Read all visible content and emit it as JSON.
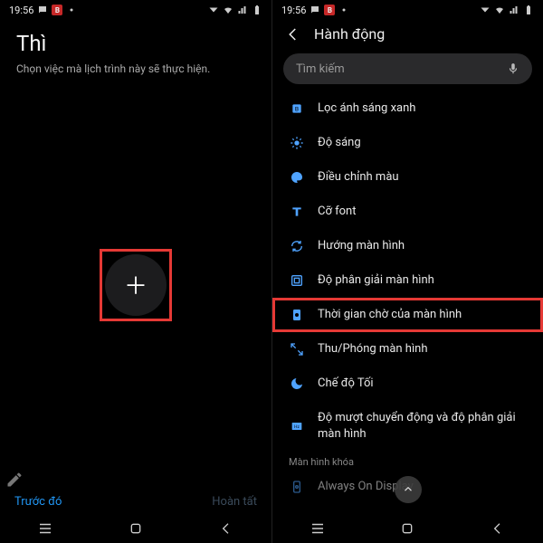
{
  "status": {
    "time": "19:56"
  },
  "left": {
    "title": "Thì",
    "subtitle": "Chọn việc mà lịch trình này sẽ thực hiện.",
    "prev": "Trước đó",
    "done": "Hoàn tất"
  },
  "right": {
    "header": "Hành động",
    "search_placeholder": "Tìm kiếm",
    "items": [
      {
        "label": "Lọc ánh sáng xanh"
      },
      {
        "label": "Độ sáng"
      },
      {
        "label": "Điều chỉnh màu"
      },
      {
        "label": "Cỡ font"
      },
      {
        "label": "Hướng màn hình"
      },
      {
        "label": "Độ phân giải màn hình"
      },
      {
        "label": "Thời gian chờ của màn hình"
      },
      {
        "label": "Thu/Phóng màn hình"
      },
      {
        "label": "Chế độ Tối"
      },
      {
        "label": "Độ mượt chuyển động và độ phân giải màn hình"
      }
    ],
    "section_label": "Màn hình khóa",
    "aod_label": "Always On Display"
  }
}
